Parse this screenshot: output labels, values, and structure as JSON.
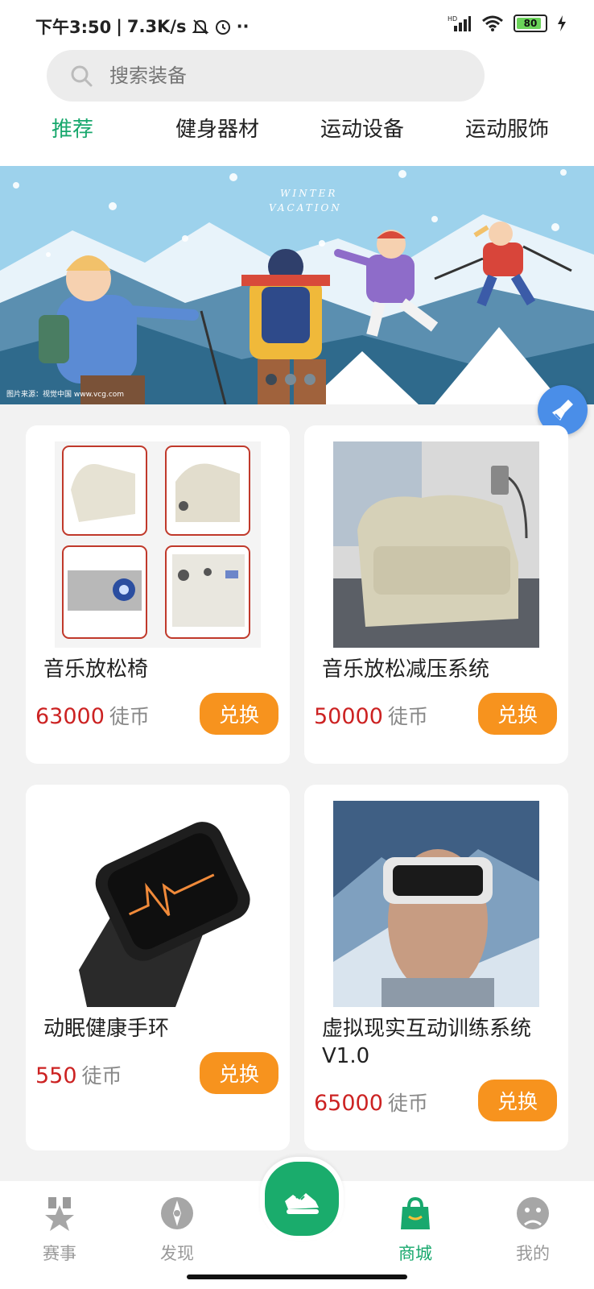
{
  "status_bar": {
    "time": "下午3:50",
    "net_speed": "7.3K/s",
    "signal": "HD",
    "battery": "80"
  },
  "search": {
    "placeholder": "搜索装备"
  },
  "tabs": [
    {
      "label": "推荐",
      "active": true
    },
    {
      "label": "健身器材",
      "active": false
    },
    {
      "label": "运动设备",
      "active": false
    },
    {
      "label": "运动服饰",
      "active": false
    }
  ],
  "banner": {
    "title_line1": "WINTER",
    "title_line2": "VACATION",
    "credit": "图片来源：视觉中国 www.vcg.com"
  },
  "products": [
    {
      "name": "音乐放松椅",
      "price": "63000",
      "unit": "徒币",
      "button": "兑换"
    },
    {
      "name": "音乐放松减压系统",
      "price": "50000",
      "unit": "徒币",
      "button": "兑换"
    },
    {
      "name": "动眠健康手环",
      "price": "550",
      "unit": "徒币",
      "button": "兑换"
    },
    {
      "name": "虚拟现实互动训练系统V1.0",
      "price": "65000",
      "unit": "徒币",
      "button": "兑换"
    }
  ],
  "bottom_nav": [
    {
      "label": "赛事",
      "icon": "medal-icon"
    },
    {
      "label": "发现",
      "icon": "compass-icon"
    },
    {
      "label": "",
      "icon": "running-shoe-icon"
    },
    {
      "label": "商城",
      "icon": "shopping-bag-icon",
      "active": true
    },
    {
      "label": "我的",
      "icon": "profile-icon"
    }
  ],
  "colors": {
    "accent": "#18a86d",
    "price": "#cc2222",
    "button": "#f7931e"
  }
}
